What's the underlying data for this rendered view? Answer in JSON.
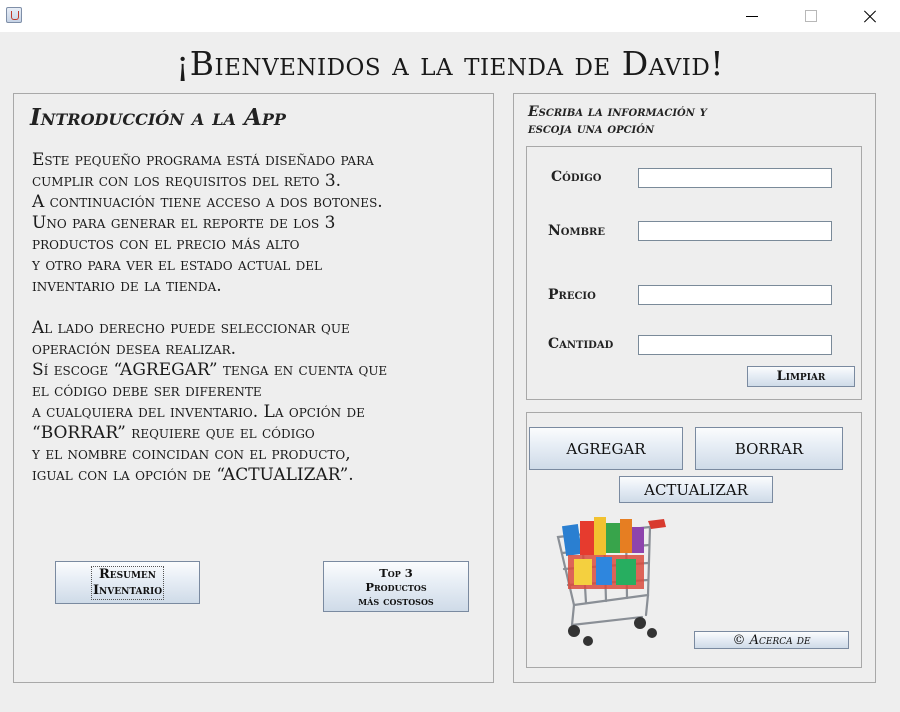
{
  "window": {
    "icon": "java-cup-icon",
    "controls": [
      "minimize-icon",
      "maximize-icon",
      "close-icon"
    ]
  },
  "header": {
    "title": "¡Bienvenidos a la tienda de David!"
  },
  "intro": {
    "heading": "Introducción a la App",
    "body": "Este pequeño programa está diseñado para\ncumplir con los requisitos del reto 3.\nA continuación tiene acceso a dos botones.\nUno para generar el reporte de los 3\nproductos con el precio más alto\ny otro para ver el estado actual del\ninventario de la tienda.\n\nAl lado derecho puede seleccionar que\noperación desea realizar.\nSí escoge “AGREGAR” tenga en cuenta que\nel código debe ser diferente\na cualquiera del inventario. La opción de\n“BORRAR” requiere que el código\ny el nombre coincidan con el producto,\nigual con la opción de “ACTUALIZAR”."
  },
  "left_buttons": {
    "resumen_line1": "Resumen",
    "resumen_line2": "Inventario",
    "top3_line1": "Top 3",
    "top3_line2": "Productos",
    "top3_line3": "más costosos"
  },
  "form": {
    "heading": "Escriba la información y\nescoja una opción",
    "fields": [
      {
        "label": "Código",
        "value": ""
      },
      {
        "label": "Nombre",
        "value": ""
      },
      {
        "label": "Precio",
        "value": ""
      },
      {
        "label": "Cantidad",
        "value": ""
      }
    ],
    "clear_label": "Limpiar"
  },
  "actions": {
    "add_label": "AGREGAR",
    "delete_label": "BORRAR",
    "update_label": "ACTUALIZAR",
    "about_label": "© Acerca de"
  },
  "image": {
    "icon": "shopping-cart-icon"
  }
}
